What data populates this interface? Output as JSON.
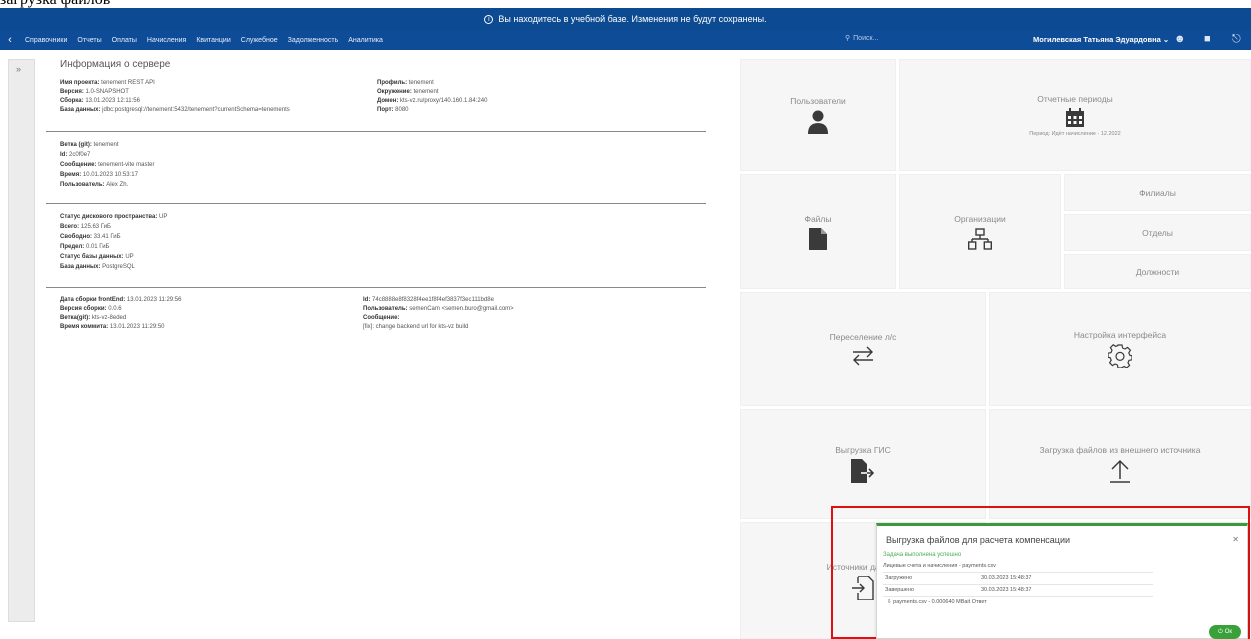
{
  "top_strip": {
    "text": "загрузка файлов"
  },
  "warning_bar": {
    "text": "Вы находитесь в учебной базе. Изменения не будут сохранены."
  },
  "nav": {
    "menu": [
      "Справочники",
      "Отчеты",
      "Оплаты",
      "Начисления",
      "Квитанции",
      "Служебное",
      "Задолженность",
      "Аналитика"
    ],
    "search_placeholder": "Поиск...",
    "user_name": "Могилевская Татьяна Эдуардовна"
  },
  "server_info": {
    "title": "Информация о сервере",
    "section1_left": [
      {
        "key": "Имя проекта:",
        "value": "tenement REST API"
      },
      {
        "key": "Версия:",
        "value": "1.0-SNAPSHOT"
      },
      {
        "key": "Сборка:",
        "value": "13.01.2023 12:11:56"
      },
      {
        "key": "База данных:",
        "value": "jdbc:postgresql://tenement:5432/tenement?currentSchema=tenements"
      }
    ],
    "section1_right": [
      {
        "key": "Профиль:",
        "value": "tenement"
      },
      {
        "key": "Окружение:",
        "value": "tenement"
      },
      {
        "key": "Домен:",
        "value": "kts-vz.ru/proxy/140.160.1.84:240"
      },
      {
        "key": "Порт:",
        "value": "8080"
      }
    ],
    "section2": [
      {
        "key": "Ветка (git):",
        "value": "tenement"
      },
      {
        "key": "Id:",
        "value": "2c0f0e7"
      },
      {
        "key": "Сообщение:",
        "value": "tenement-vite master"
      },
      {
        "key": "Время:",
        "value": "10.01.2023 10:53:17"
      },
      {
        "key": "Пользователь:",
        "value": "Alex Zh."
      }
    ],
    "section3": [
      {
        "key": "Статус дискового пространства:",
        "value": "UP"
      },
      {
        "key": "Всего:",
        "value": "125.63 ГиБ"
      },
      {
        "key": "Свободно:",
        "value": "33.41 ГиБ"
      },
      {
        "key": "Предел:",
        "value": "0.01 ГиБ"
      },
      {
        "key": "Статус базы данных:",
        "value": "UP"
      },
      {
        "key": "База данных:",
        "value": "PostgreSQL"
      }
    ],
    "section4_left": [
      {
        "key": "Дата сборки frontEnd:",
        "value": "13.01.2023 11:29:56"
      },
      {
        "key": "Версия сборки:",
        "value": "0.0.6"
      },
      {
        "key": "Ветка(git):",
        "value": "kts-vz-8eded"
      },
      {
        "key": "Время коммита:",
        "value": "13.01.2023 11:29:50"
      }
    ],
    "section4_right": [
      {
        "key": "Id:",
        "value": "74c8888e8f8328f4ee1f8f4ef3837f3ec111bd8e"
      },
      {
        "key": "Пользователь:",
        "value": "semenCam <semen.buro@gmail.com>"
      },
      {
        "key": "Сообщение:",
        "value": ""
      },
      {
        "key": "",
        "value": "[fix]: change backend url for kts-vz build"
      }
    ]
  },
  "tiles": {
    "users": "Пользователи",
    "periods": "Отчетные периоды",
    "periods_sub": "Период: Идёт начисление - 12.2022",
    "files": "Файлы",
    "orgs": "Организации",
    "branches": "Филиалы",
    "departments": "Отделы",
    "positions": "Должности",
    "transfer": "Переселение л/с",
    "interface": "Настройка интерфейса",
    "gis": "Выгрузка ГИС",
    "external": "Загрузка файлов из внешнего источника",
    "sources": "Источники данных"
  },
  "popup": {
    "title": "Выгрузка файлов для расчета компенсации",
    "status": "Задача выполнена успешно",
    "row_file": "Лицевые счета и начисления - payments.csv",
    "row_loaded_label": "Загружено",
    "row_loaded_value": "30.03.2023 15:48:37",
    "row_done_label": "Завершено",
    "row_done_value": "30.03.2023 15:48:37",
    "row_result": "payments.csv - 0.000640 MBait Ответ",
    "toggle": "Ок"
  }
}
